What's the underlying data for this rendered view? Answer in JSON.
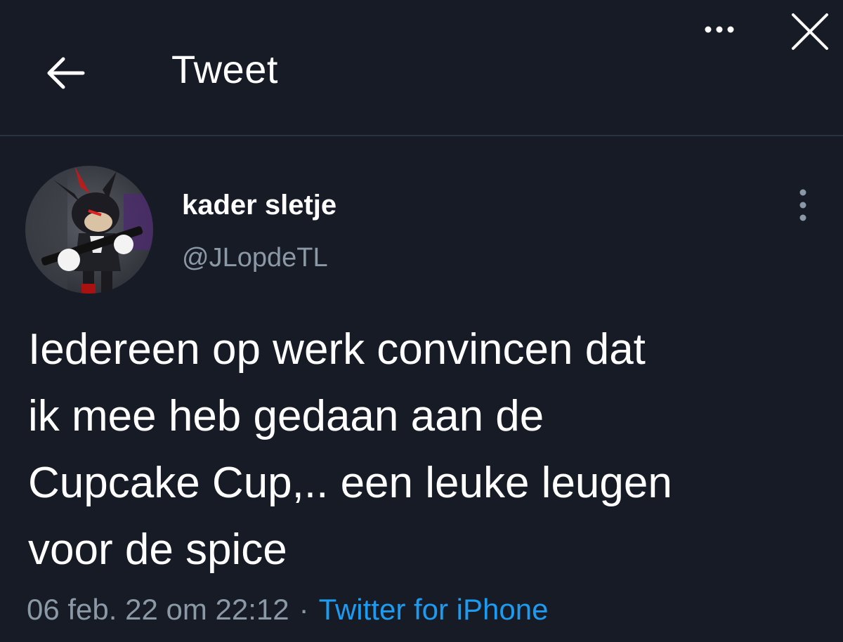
{
  "header": {
    "title": "Tweet",
    "back_icon": "arrow-left-icon",
    "more_icon": "more-horizontal-icon",
    "close_icon": "close-icon"
  },
  "tweet": {
    "author": {
      "display_name": "kader sletje",
      "handle": "@JLopdeTL",
      "avatar": "avatar-image"
    },
    "text": "Iedereen op werk convincen dat\nik mee heb gedaan aan de\nCupcake Cup,.. een leuke leugen\nvoor de spice",
    "timestamp": "06 feb. 22 om 22:12",
    "separator": "·",
    "source": "Twitter for iPhone",
    "more_icon": "more-vertical-icon"
  },
  "colors": {
    "background": "#171b26",
    "text": "#ffffff",
    "muted": "#8b98a5",
    "link": "#1d9bf0"
  }
}
